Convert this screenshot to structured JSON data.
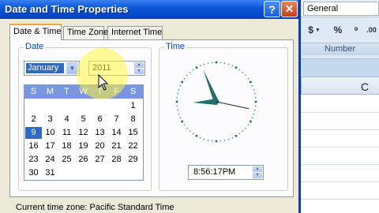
{
  "excel": {
    "number_format": "General",
    "buttons": [
      {
        "label": "$",
        "icon": "currency-icon"
      },
      {
        "label": "%",
        "icon": "percent-icon"
      },
      {
        "label": "⁹",
        "icon": "comma-style-icon"
      },
      {
        "label": ".00",
        "icon": "increase-decimal-icon"
      }
    ],
    "group_label": "Number",
    "column_header": "C"
  },
  "dialog": {
    "title": "Date and Time Properties",
    "help_label": "?",
    "close_label": "✕",
    "tabs": [
      "Date & Time",
      "Time Zone",
      "Internet Time"
    ],
    "date_group_label": "Date",
    "time_group_label": "Time",
    "month": "January",
    "year": "2011",
    "weekdays": [
      "S",
      "M",
      "T",
      "W",
      "T",
      "F",
      "S"
    ],
    "weeks": [
      [
        "",
        "",
        "",
        "",
        "",
        "",
        "1"
      ],
      [
        "2",
        "3",
        "4",
        "5",
        "6",
        "7",
        "8"
      ],
      [
        "9",
        "10",
        "11",
        "12",
        "13",
        "14",
        "15"
      ],
      [
        "16",
        "17",
        "18",
        "19",
        "20",
        "21",
        "22"
      ],
      [
        "23",
        "24",
        "25",
        "26",
        "27",
        "28",
        "29"
      ],
      [
        "30",
        "31",
        "",
        "",
        "",
        "",
        ""
      ]
    ],
    "selected_day": "9",
    "time": "8:56:17PM",
    "clock": {
      "hour": 8,
      "minute": 56,
      "second": 17
    },
    "timezone_text": "Current time zone:  Pacific Standard Time"
  },
  "colors": {
    "title_bar": "#0a56d8",
    "calendar_header": "#7a96df",
    "selection": "#316ac5",
    "clock_hands": "#1e6f6a",
    "highlight": "#fff53c"
  }
}
